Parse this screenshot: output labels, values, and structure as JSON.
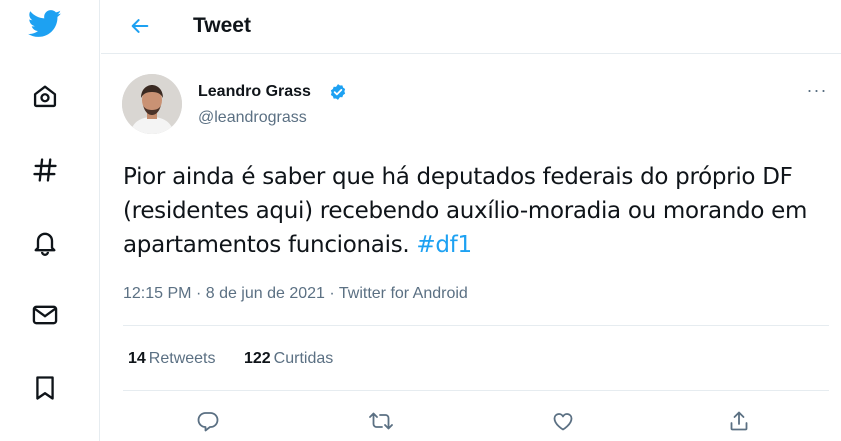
{
  "sidebar": {
    "items": [
      {
        "icon": "twitter-bird-icon"
      },
      {
        "icon": "home-icon"
      },
      {
        "icon": "hashtag-icon"
      },
      {
        "icon": "bell-icon"
      },
      {
        "icon": "mail-icon"
      },
      {
        "icon": "bookmark-icon"
      }
    ],
    "accent_color": "#1da1f2"
  },
  "header": {
    "title": "Tweet",
    "back_icon": "arrow-left-icon"
  },
  "tweet": {
    "author": {
      "name": "Leandro Grass",
      "handle": "@leandrograss",
      "verified": true
    },
    "text_main": "Pior ainda é saber que há deputados federais do próprio DF (residentes aqui) recebendo auxílio-moradia ou morando em apartamentos funcionais.",
    "hashtag": "#df1",
    "more_label": "···",
    "meta": {
      "time": "12:15 PM",
      "separator": "·",
      "date": "8 de jun de 2021",
      "source": "Twitter for Android"
    },
    "stats": {
      "retweets_count": "14",
      "retweets_label": "Retweets",
      "likes_count": "122",
      "likes_label": "Curtidas"
    },
    "actions": [
      "reply-icon",
      "retweet-icon",
      "like-icon",
      "share-icon"
    ]
  },
  "colors": {
    "accent": "#1da1f2",
    "text": "#0f1419",
    "secondary": "#5b7083",
    "border": "#e6ecf0"
  }
}
